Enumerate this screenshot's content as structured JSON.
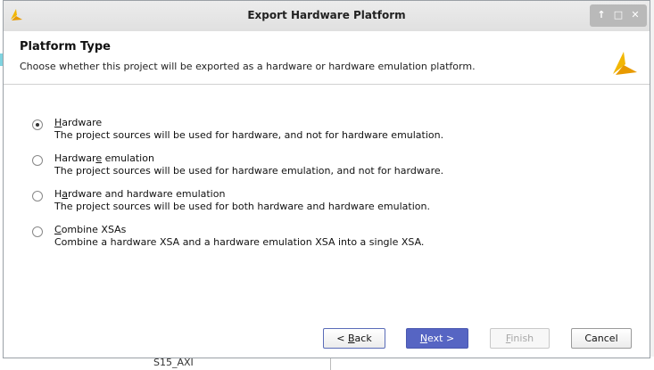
{
  "window": {
    "title": "Export Hardware Platform"
  },
  "header": {
    "title": "Platform Type",
    "description": "Choose whether this project will be exported as a hardware or hardware emulation platform."
  },
  "options": [
    {
      "label_pre": "",
      "label_mnemonic": "H",
      "label_post": "ardware",
      "description": "The project sources will be used for hardware, and not for hardware emulation.",
      "selected": true
    },
    {
      "label_pre": "Hardwar",
      "label_mnemonic": "e",
      "label_post": " emulation",
      "description": "The project sources will be used for hardware emulation, and not for hardware.",
      "selected": false
    },
    {
      "label_pre": "H",
      "label_mnemonic": "a",
      "label_post": "rdware and hardware emulation",
      "description": "The project sources will be used for both hardware and hardware emulation.",
      "selected": false
    },
    {
      "label_pre": "",
      "label_mnemonic": "C",
      "label_post": "ombine XSAs",
      "description": "Combine a hardware XSA and a hardware emulation XSA into a single XSA.",
      "selected": false
    }
  ],
  "buttons": {
    "back_pre": "< ",
    "back_mnemonic": "B",
    "back_post": "ack",
    "next_mnemonic": "N",
    "next_post": "ext >",
    "finish_mnemonic": "F",
    "finish_post": "inish",
    "finish_enabled": false,
    "cancel": "Cancel"
  },
  "background": {
    "bottom_fragment": "S15_AXI"
  },
  "colors": {
    "primary_button": "#5665c3",
    "logo": "#f2b705"
  }
}
